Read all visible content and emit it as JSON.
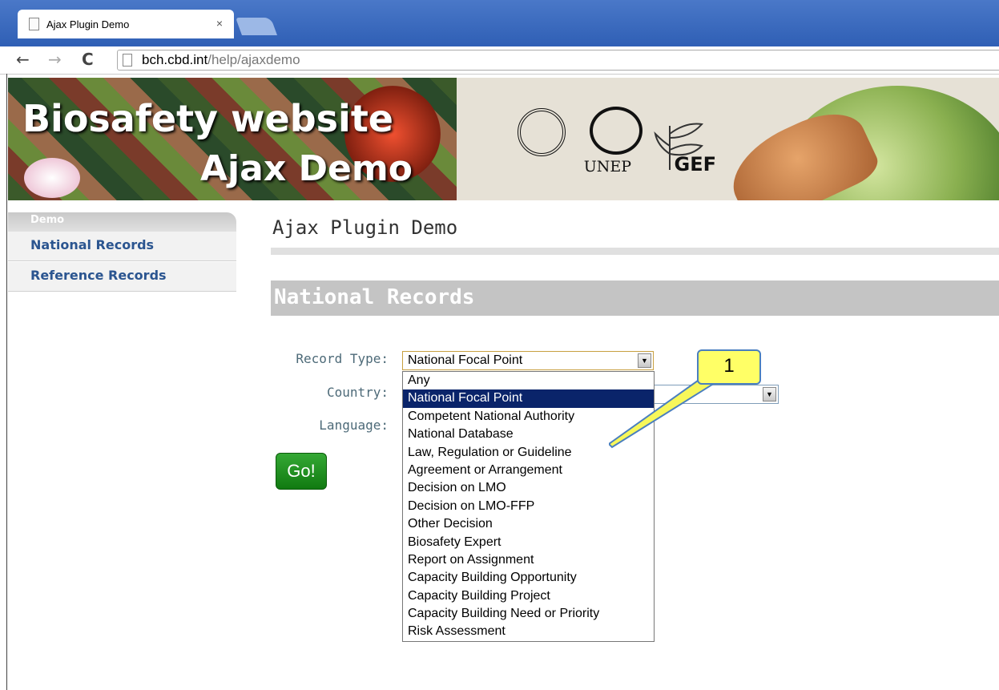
{
  "browser": {
    "tab_title": "Ajax Plugin Demo",
    "tab_close": "×",
    "url_host": "bch.cbd.int",
    "url_path": "/help/ajaxdemo",
    "back": "←",
    "forward": "→",
    "reload": "C"
  },
  "banner": {
    "line1": "Biosafety website",
    "line2": "Ajax Demo",
    "logo_unep": "UNEP",
    "logo_gef": "GEF"
  },
  "sidebar": {
    "header": "Demo",
    "items": [
      {
        "label": "National Records"
      },
      {
        "label": "Reference Records"
      }
    ]
  },
  "main": {
    "title": "Ajax Plugin Demo",
    "section": "National Records",
    "form": {
      "record_type_label": "Record Type:",
      "record_type_value": "National Focal Point",
      "country_label": "Country:",
      "language_label": "Language:",
      "go_label": "Go!"
    },
    "dropdown_options": [
      "Any",
      "National Focal Point",
      "Competent National Authority",
      "National Database",
      "Law, Regulation or Guideline",
      "Agreement or Arrangement",
      "Decision on LMO",
      "Decision on LMO-FFP",
      "Other Decision",
      "Biosafety Expert",
      "Report on Assignment",
      "Capacity Building Opportunity",
      "Capacity Building Project",
      "Capacity Building Need or Priority",
      "Risk Assessment"
    ],
    "selected_index": 1
  },
  "callout": {
    "label": "1"
  },
  "colors": {
    "selected_option_bg": "#0a246a",
    "go_button": "#1f8f1f",
    "callout_bg": "#ffff66",
    "sidebar_link": "#2b5590"
  }
}
